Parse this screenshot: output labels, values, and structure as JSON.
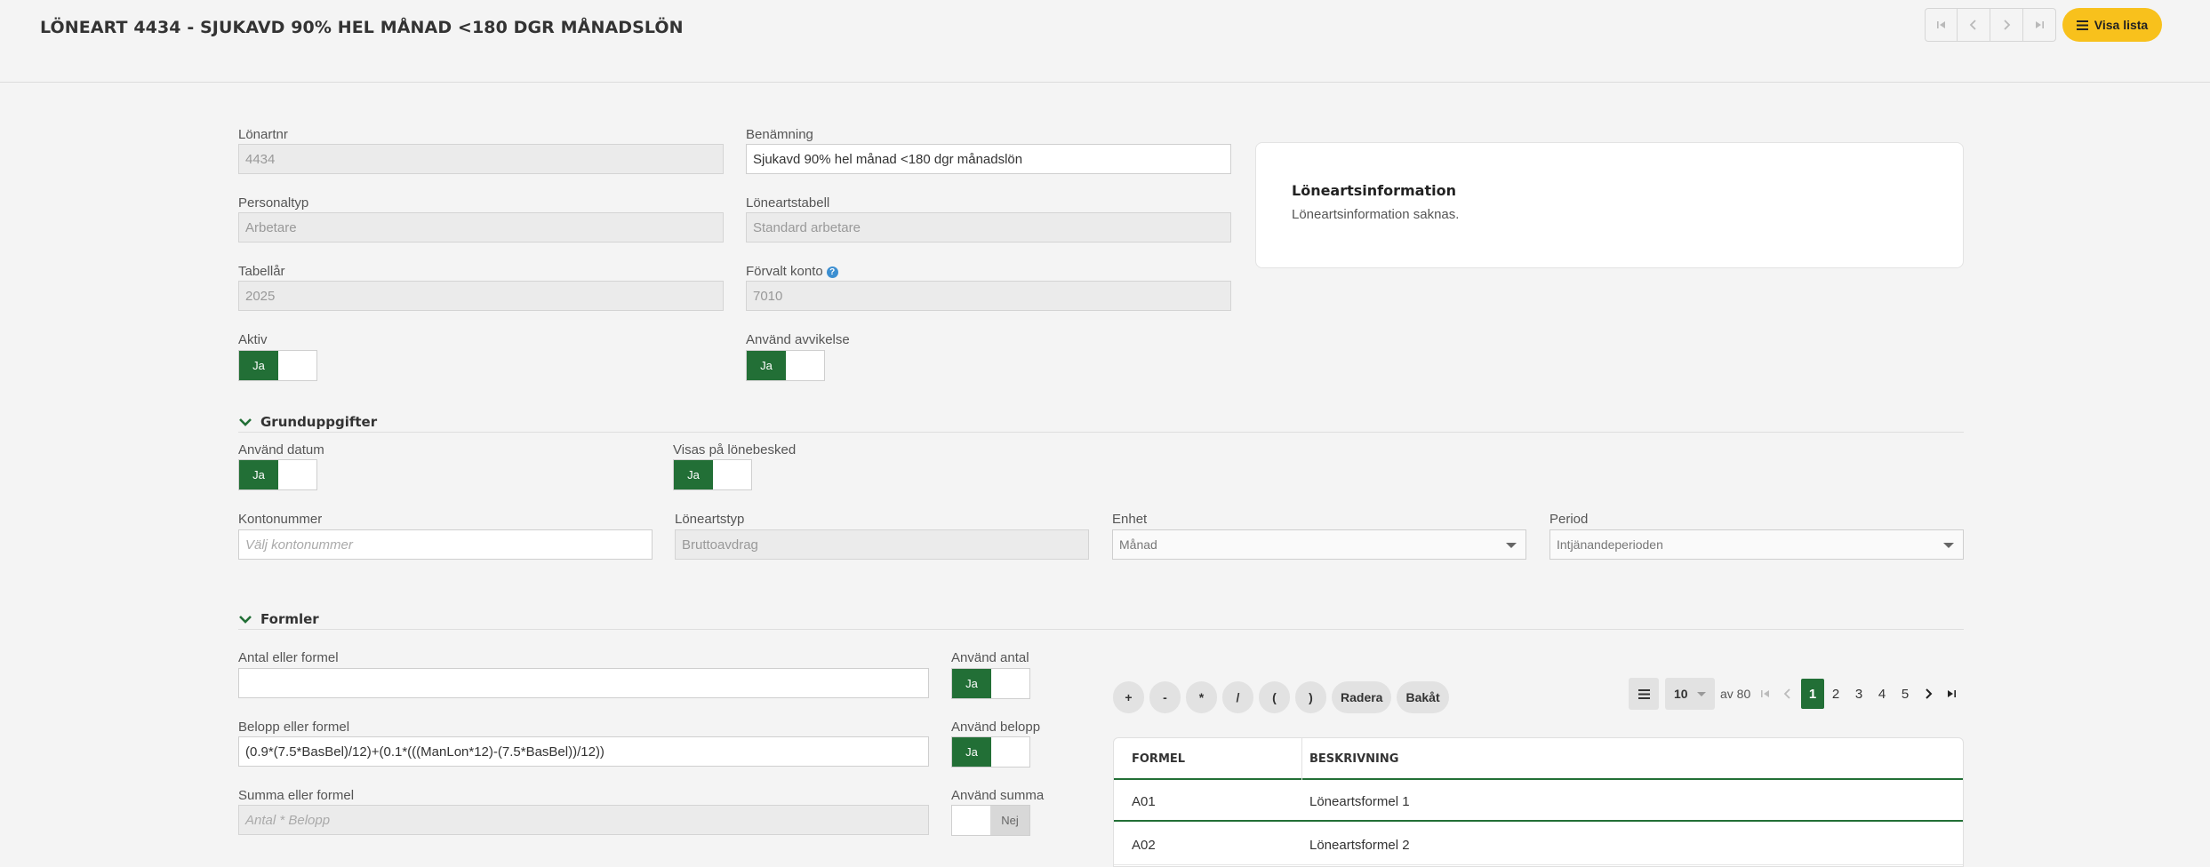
{
  "header": {
    "title": "LÖNEART 4434 - SJUKAVD 90% HEL MÅNAD <180 DGR MÅNADSLÖN",
    "visa_lista": "Visa lista"
  },
  "form": {
    "lonartnr": {
      "label": "Lönartnr",
      "value": "4434"
    },
    "benamning": {
      "label": "Benämning",
      "value": "Sjukavd 90% hel månad <180 dgr månadslön"
    },
    "personaltyp": {
      "label": "Personaltyp",
      "value": "Arbetare"
    },
    "loneartstabell": {
      "label": "Löneartstabell",
      "value": "Standard arbetare"
    },
    "tabellar": {
      "label": "Tabellår",
      "value": "2025"
    },
    "forvalt_konto": {
      "label": "Förvalt konto",
      "value": "7010"
    },
    "aktiv": {
      "label": "Aktiv",
      "value": "Ja"
    },
    "anvand_avvikelse": {
      "label": "Använd avvikelse",
      "value": "Ja"
    }
  },
  "info_card": {
    "title": "Löneartsinformation",
    "text": "Löneartsinformation saknas."
  },
  "grunduppgifter": {
    "heading": "Grunduppgifter",
    "anvand_datum": {
      "label": "Använd datum",
      "value": "Ja"
    },
    "visas_pa_lonebesked": {
      "label": "Visas på lönebesked",
      "value": "Ja"
    },
    "kontonummer": {
      "label": "Kontonummer",
      "placeholder": "Välj kontonummer"
    },
    "loneartstyp": {
      "label": "Löneartstyp",
      "value": "Bruttoavdrag"
    },
    "enhet": {
      "label": "Enhet",
      "value": "Månad"
    },
    "period": {
      "label": "Period",
      "value": "Intjänandeperioden"
    }
  },
  "formler": {
    "heading": "Formler",
    "antal": {
      "label": "Antal eller formel",
      "value": ""
    },
    "anvand_antal": {
      "label": "Använd antal",
      "value": "Ja"
    },
    "belopp": {
      "label": "Belopp eller formel",
      "value": "(0.9*(7.5*BasBel)/12)+(0.1*(((ManLon*12)-(7.5*BasBel))/12))"
    },
    "anvand_belopp": {
      "label": "Använd belopp",
      "value": "Ja"
    },
    "summa": {
      "label": "Summa eller formel",
      "placeholder": "Antal * Belopp"
    },
    "anvand_summa": {
      "label": "Använd summa",
      "value": "Nej"
    },
    "operators": [
      "+",
      "-",
      "*",
      "/",
      "(",
      ")",
      "Radera",
      "Bakåt"
    ]
  },
  "pagination": {
    "page_size": "10",
    "total_text": "av 80",
    "pages": [
      "1",
      "2",
      "3",
      "4",
      "5"
    ],
    "current_page": "1"
  },
  "formula_table": {
    "columns": [
      "FORMEL",
      "BESKRIVNING"
    ],
    "rows": [
      {
        "formel": "A01",
        "beskrivning": "Löneartsformel 1"
      },
      {
        "formel": "A02",
        "beskrivning": "Löneartsformel 2"
      }
    ]
  },
  "colors": {
    "accent_green": "#226f36",
    "button_yellow": "#f8c11c"
  }
}
